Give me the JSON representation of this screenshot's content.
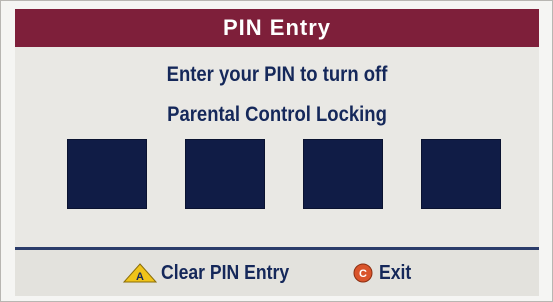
{
  "dialog": {
    "title": "PIN Entry",
    "message_line1": "Enter your PIN to turn off",
    "message_line2": "Parental Control Locking",
    "pin_slots": [
      "",
      "",
      "",
      ""
    ]
  },
  "footer": {
    "clear": {
      "key": "A",
      "label": "Clear PIN Entry",
      "icon": "triangle-a-button-icon"
    },
    "exit": {
      "key": "C",
      "label": "Exit",
      "icon": "circle-c-button-icon"
    }
  },
  "colors": {
    "title_bar": "#7e1f3a",
    "text": "#15285a",
    "pin_box": "#101c46",
    "button_a": "#f0c419",
    "button_c": "#d9542b"
  }
}
